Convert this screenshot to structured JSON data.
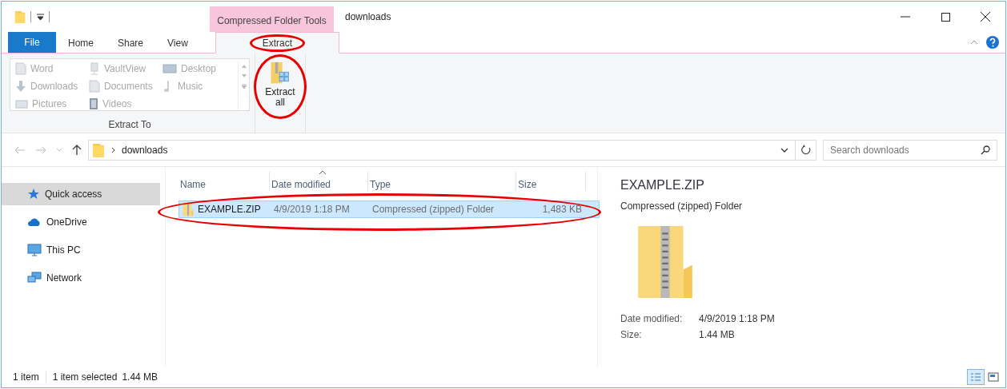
{
  "window": {
    "title": "downloads",
    "context_tab_group": "Compressed Folder Tools"
  },
  "ribbon_tabs": [
    {
      "label": "File",
      "kind": "file",
      "selected": false,
      "circled": false
    },
    {
      "label": "Home",
      "kind": "plain",
      "selected": false,
      "circled": false
    },
    {
      "label": "Share",
      "kind": "plain",
      "selected": false,
      "circled": false
    },
    {
      "label": "View",
      "kind": "plain",
      "selected": false,
      "circled": false
    },
    {
      "label": "Extract",
      "kind": "context",
      "selected": true,
      "circled": true
    }
  ],
  "extract_to": {
    "group_label": "Extract To",
    "locations": [
      {
        "label": "Word",
        "kind": "doc",
        "disabled": true
      },
      {
        "label": "VaultView",
        "kind": "drive",
        "disabled": true
      },
      {
        "label": "Desktop",
        "kind": "desktop",
        "disabled": true
      },
      {
        "label": "Downloads",
        "kind": "download",
        "disabled": true
      },
      {
        "label": "Documents",
        "kind": "doc",
        "disabled": true
      },
      {
        "label": "Music",
        "kind": "music",
        "disabled": true
      },
      {
        "label": "Pictures",
        "kind": "pictures",
        "disabled": true
      },
      {
        "label": "Videos",
        "kind": "videos",
        "disabled": true
      }
    ]
  },
  "extract_all": {
    "label": "Extract all",
    "circled": true
  },
  "address": {
    "path": [
      "downloads"
    ]
  },
  "search": {
    "placeholder": "Search downloads"
  },
  "nav": {
    "items": [
      {
        "label": "Quick access",
        "kind": "star",
        "selected": true
      },
      {
        "label": "OneDrive",
        "kind": "cloud",
        "selected": false
      },
      {
        "label": "This PC",
        "kind": "pc",
        "selected": false
      },
      {
        "label": "Network",
        "kind": "network",
        "selected": false
      }
    ]
  },
  "file_list": {
    "columns": [
      {
        "label": "Name",
        "sorted": false
      },
      {
        "label": "Date modified",
        "sorted": true
      },
      {
        "label": "Type",
        "sorted": false
      },
      {
        "label": "Size",
        "sorted": false
      }
    ],
    "rows": [
      {
        "name": "EXAMPLE.ZIP",
        "date": "4/9/2019 1:18 PM",
        "type": "Compressed (zipped) Folder",
        "size": "1,483 KB",
        "selected": true,
        "circled": true
      }
    ]
  },
  "preview": {
    "title": "EXAMPLE.ZIP",
    "subtitle": "Compressed (zipped) Folder",
    "details": [
      {
        "label": "Date modified:",
        "value": "4/9/2019 1:18 PM"
      },
      {
        "label": "Size:",
        "value": "1.44 MB"
      }
    ]
  },
  "status_bar": {
    "item_count": "1 item",
    "selection": "1 item selected",
    "selection_size": "1.44 MB",
    "view_buttons": [
      {
        "kind": "details",
        "selected": true
      },
      {
        "kind": "preview",
        "selected": false
      }
    ]
  }
}
